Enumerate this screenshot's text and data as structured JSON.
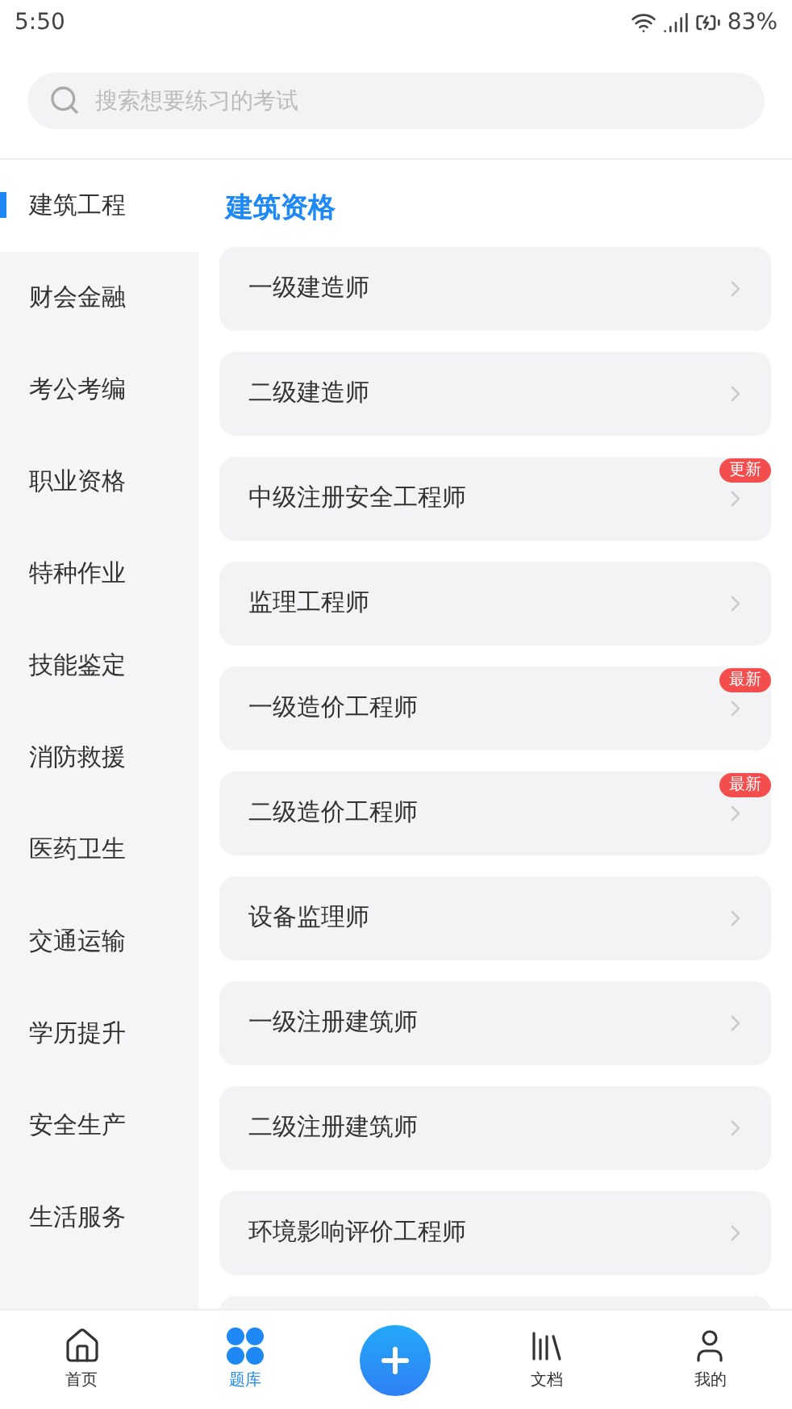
{
  "status_bar": {
    "time": "5:50",
    "battery": "83%"
  },
  "search": {
    "placeholder": "搜索想要练习的考试"
  },
  "sidebar": {
    "items": [
      {
        "label": "建筑工程",
        "selected": true
      },
      {
        "label": "财会金融",
        "selected": false
      },
      {
        "label": "考公考编",
        "selected": false
      },
      {
        "label": "职业资格",
        "selected": false
      },
      {
        "label": "特种作业",
        "selected": false
      },
      {
        "label": "技能鉴定",
        "selected": false
      },
      {
        "label": "消防救援",
        "selected": false
      },
      {
        "label": "医药卫生",
        "selected": false
      },
      {
        "label": "交通运输",
        "selected": false
      },
      {
        "label": "学历提升",
        "selected": false
      },
      {
        "label": "安全生产",
        "selected": false
      },
      {
        "label": "生活服务",
        "selected": false
      }
    ]
  },
  "section_title": "建筑资格",
  "exams": [
    {
      "name": "一级建造师"
    },
    {
      "name": "二级建造师"
    },
    {
      "name": "中级注册安全工程师",
      "badge": "更新"
    },
    {
      "name": "监理工程师"
    },
    {
      "name": "一级造价工程师",
      "badge": "最新"
    },
    {
      "name": "二级造价工程师",
      "badge": "最新"
    },
    {
      "name": "设备监理师"
    },
    {
      "name": "一级注册建筑师"
    },
    {
      "name": "二级注册建筑师"
    },
    {
      "name": "环境影响评价工程师"
    }
  ],
  "bottom_nav": [
    {
      "kind": "home",
      "label": "首页",
      "selected": false
    },
    {
      "kind": "grid",
      "label": "题库",
      "selected": true
    },
    {
      "kind": "add"
    },
    {
      "kind": "docs",
      "label": "文档",
      "selected": false
    },
    {
      "kind": "user",
      "label": "我的",
      "selected": false
    }
  ]
}
